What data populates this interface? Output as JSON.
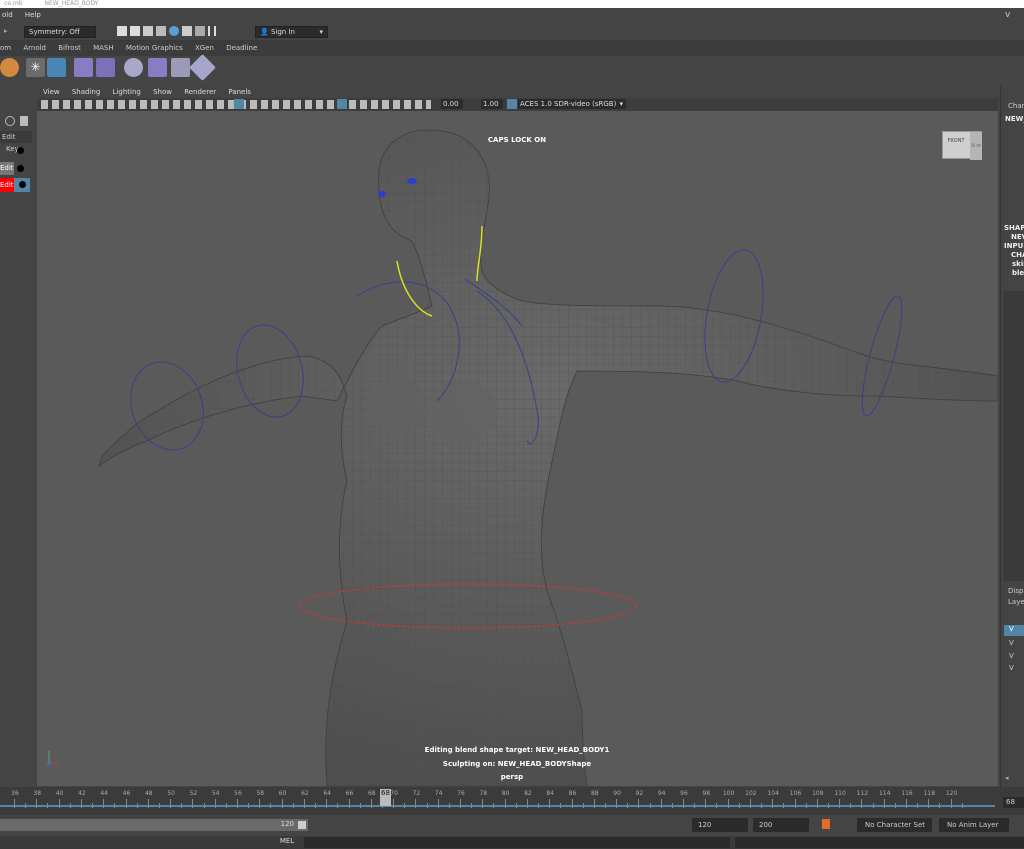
{
  "titlebar": {
    "left": "ce.mb",
    "file": "NEW_HEAD_BODY"
  },
  "menubar": {
    "items": [
      "old",
      "Help"
    ],
    "right": "V"
  },
  "status": {
    "symmetry": "Symmetry: Off",
    "sign_in": "Sign In"
  },
  "shelf_tabs": [
    "om",
    "Arnold",
    "Bifrost",
    "MASH",
    "Motion Graphics",
    "XGen",
    "Deadline"
  ],
  "viewport": {
    "menu": [
      "View",
      "Shading",
      "Lighting",
      "Show",
      "Renderer",
      "Panels"
    ],
    "exposure": "0.00",
    "gamma": "1.00",
    "color_space": "ACES 1.0 SDR-video (sRGB)",
    "caps": "CAPS LOCK ON",
    "hud_line1": "Editing blend shape target: NEW_HEAD_BODY1",
    "hud_line2": "Sculpting on: NEW_HEAD_BODYShape",
    "camera": "persp",
    "viewcube_front": "FRONT",
    "viewcube_side": "Ri ht"
  },
  "left_panel": {
    "edit_label": "Edit",
    "key_label": "Key",
    "rows": [
      "Edit",
      "Edit"
    ]
  },
  "right_panel": {
    "chan": "Chan",
    "new": "NEW_",
    "items": [
      "SHAP",
      "NEV",
      "INPU",
      "CHA",
      "skir",
      "blei"
    ],
    "disp": "Disp",
    "laye": "Laye",
    "layer_vis": [
      "V",
      "V",
      "V",
      "V"
    ]
  },
  "timeline": {
    "ticks": [
      "36",
      "38",
      "40",
      "42",
      "44",
      "46",
      "48",
      "50",
      "52",
      "54",
      "56",
      "58",
      "60",
      "62",
      "64",
      "66",
      "68",
      "70",
      "72",
      "74",
      "76",
      "78",
      "80",
      "82",
      "84",
      "86",
      "88",
      "90",
      "92",
      "94",
      "96",
      "98",
      "100",
      "102",
      "104",
      "106",
      "108",
      "110",
      "112",
      "114",
      "116",
      "118",
      "120"
    ],
    "current_frame": "68",
    "current_field": "68"
  },
  "range": {
    "end_label": "120",
    "start_field": "120",
    "end_field": "200",
    "char_set": "No Character Set",
    "anim_layer": "No Anim Layer"
  },
  "cmdline": {
    "lang": "MEL"
  },
  "colors": {
    "accent": "#5285a6",
    "key_red": "#ff0000",
    "mesh": "#5c5c5c"
  }
}
